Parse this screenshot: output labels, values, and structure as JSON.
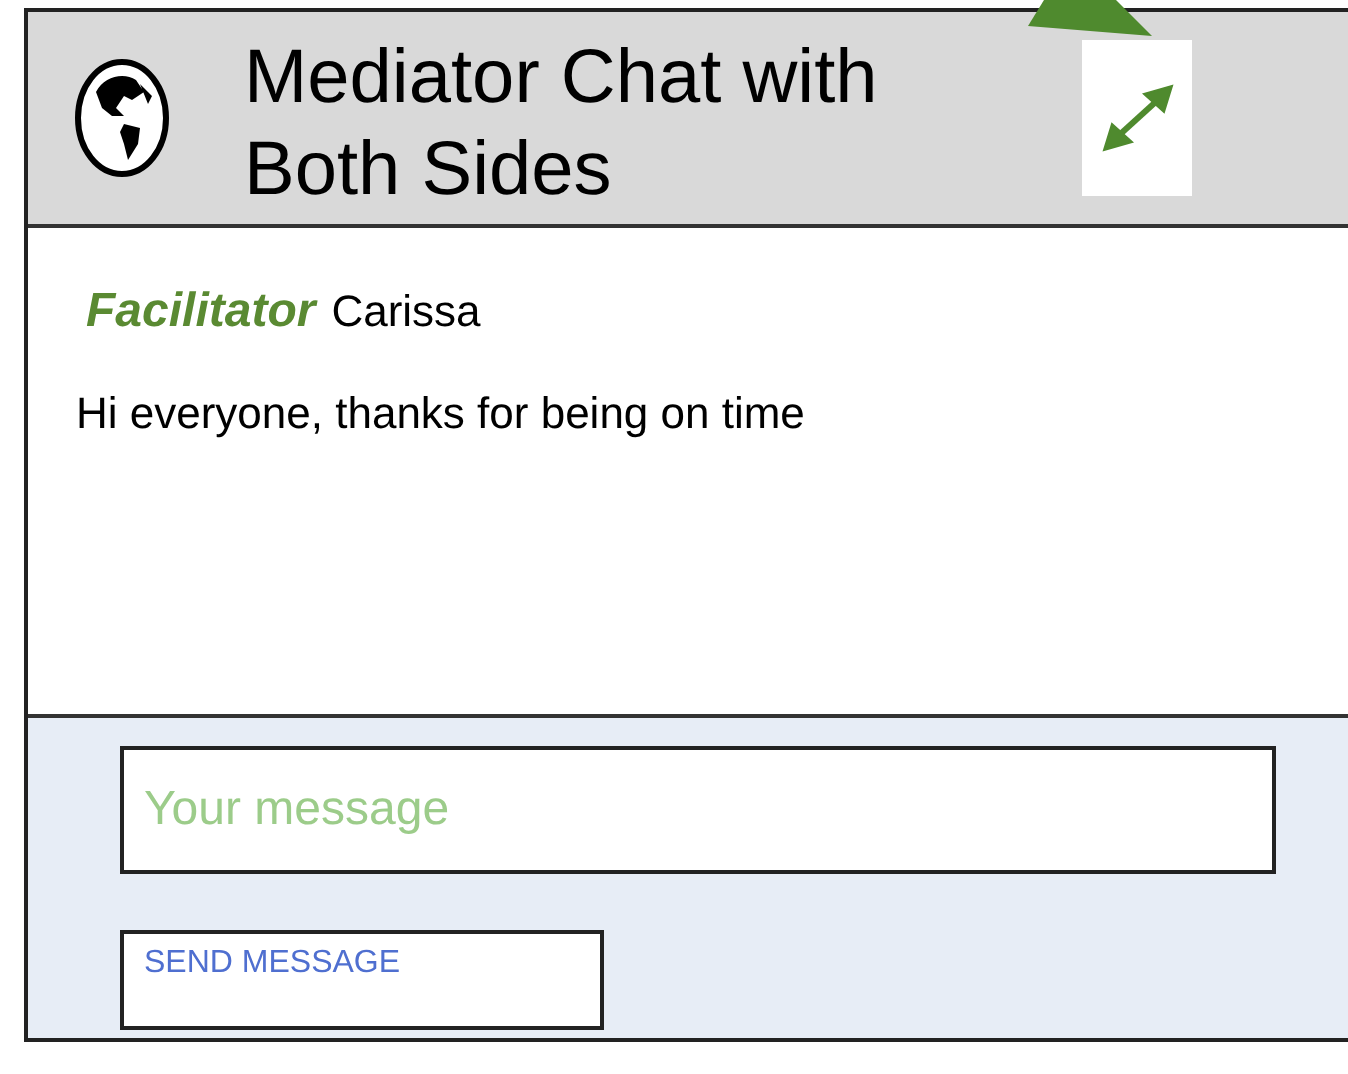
{
  "header": {
    "title": "Mediator Chat with Both Sides"
  },
  "messages": [
    {
      "role": "Facilitator",
      "sender": "Carissa",
      "text": "Hi everyone, thanks for being on time"
    }
  ],
  "composer": {
    "placeholder": "Your message",
    "send_button": "SEND MESSAGE"
  }
}
